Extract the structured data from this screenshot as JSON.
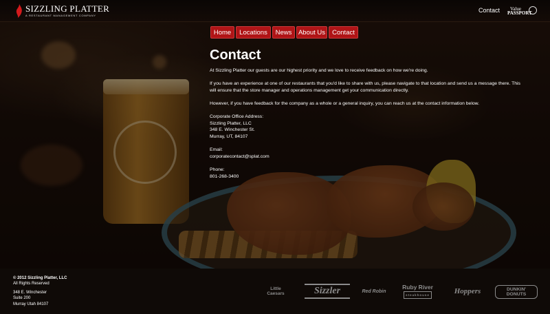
{
  "header": {
    "logo_title": "SIZZLING PLATTER",
    "logo_subtitle": "A RESTAURANT MANAGEMENT COMPANY",
    "contact_link": "Contact",
    "value_passport_line1": "Value",
    "value_passport_line2": "PASSPORT"
  },
  "nav": {
    "items": [
      {
        "label": "Home"
      },
      {
        "label": "Locations"
      },
      {
        "label": "News"
      },
      {
        "label": "About Us"
      },
      {
        "label": "Contact"
      }
    ],
    "color": "#b01416"
  },
  "main": {
    "title": "Contact",
    "para1": "At Sizzling Platter our guests are our highest priority and we love to receive feedback on how we're doing.",
    "para2": "If you have an experience at one of our restaurants that you'd like to share with us, please navigate to that location and send us a message there. This will ensure that the store manager and operations management get your communication directly.",
    "para3": "However, if you have feedback for the company as a whole or a general inquiry, you can reach us at the contact information below.",
    "address_label": "Corporate Office Address:",
    "address_name": "Sizzling Platter, LLC",
    "address_street": "348 E. Winchester St.",
    "address_city": "Murray, UT, 84107",
    "email_label": "Email:",
    "email": "corporatecontact@splat.com",
    "phone_label": "Phone:",
    "phone": "801-268-3400"
  },
  "footer": {
    "copyright": "© 2012 Sizzling Platter, LLC",
    "rights": "All Rights Reserved",
    "addr1": "348 E. Winchester",
    "addr2": "Suite 200",
    "addr3": "Murray Utah 84107",
    "brands": {
      "little_caesars_1": "Little",
      "little_caesars_2": "Caesars",
      "sizzler": "Sizzler",
      "red_robin": "Red Robin",
      "ruby_river": "Ruby River",
      "ruby_river_sub": "steakhouse",
      "hoppers": "Hoppers",
      "dunkin_1": "DUNKIN'",
      "dunkin_2": "DONUTS"
    }
  }
}
